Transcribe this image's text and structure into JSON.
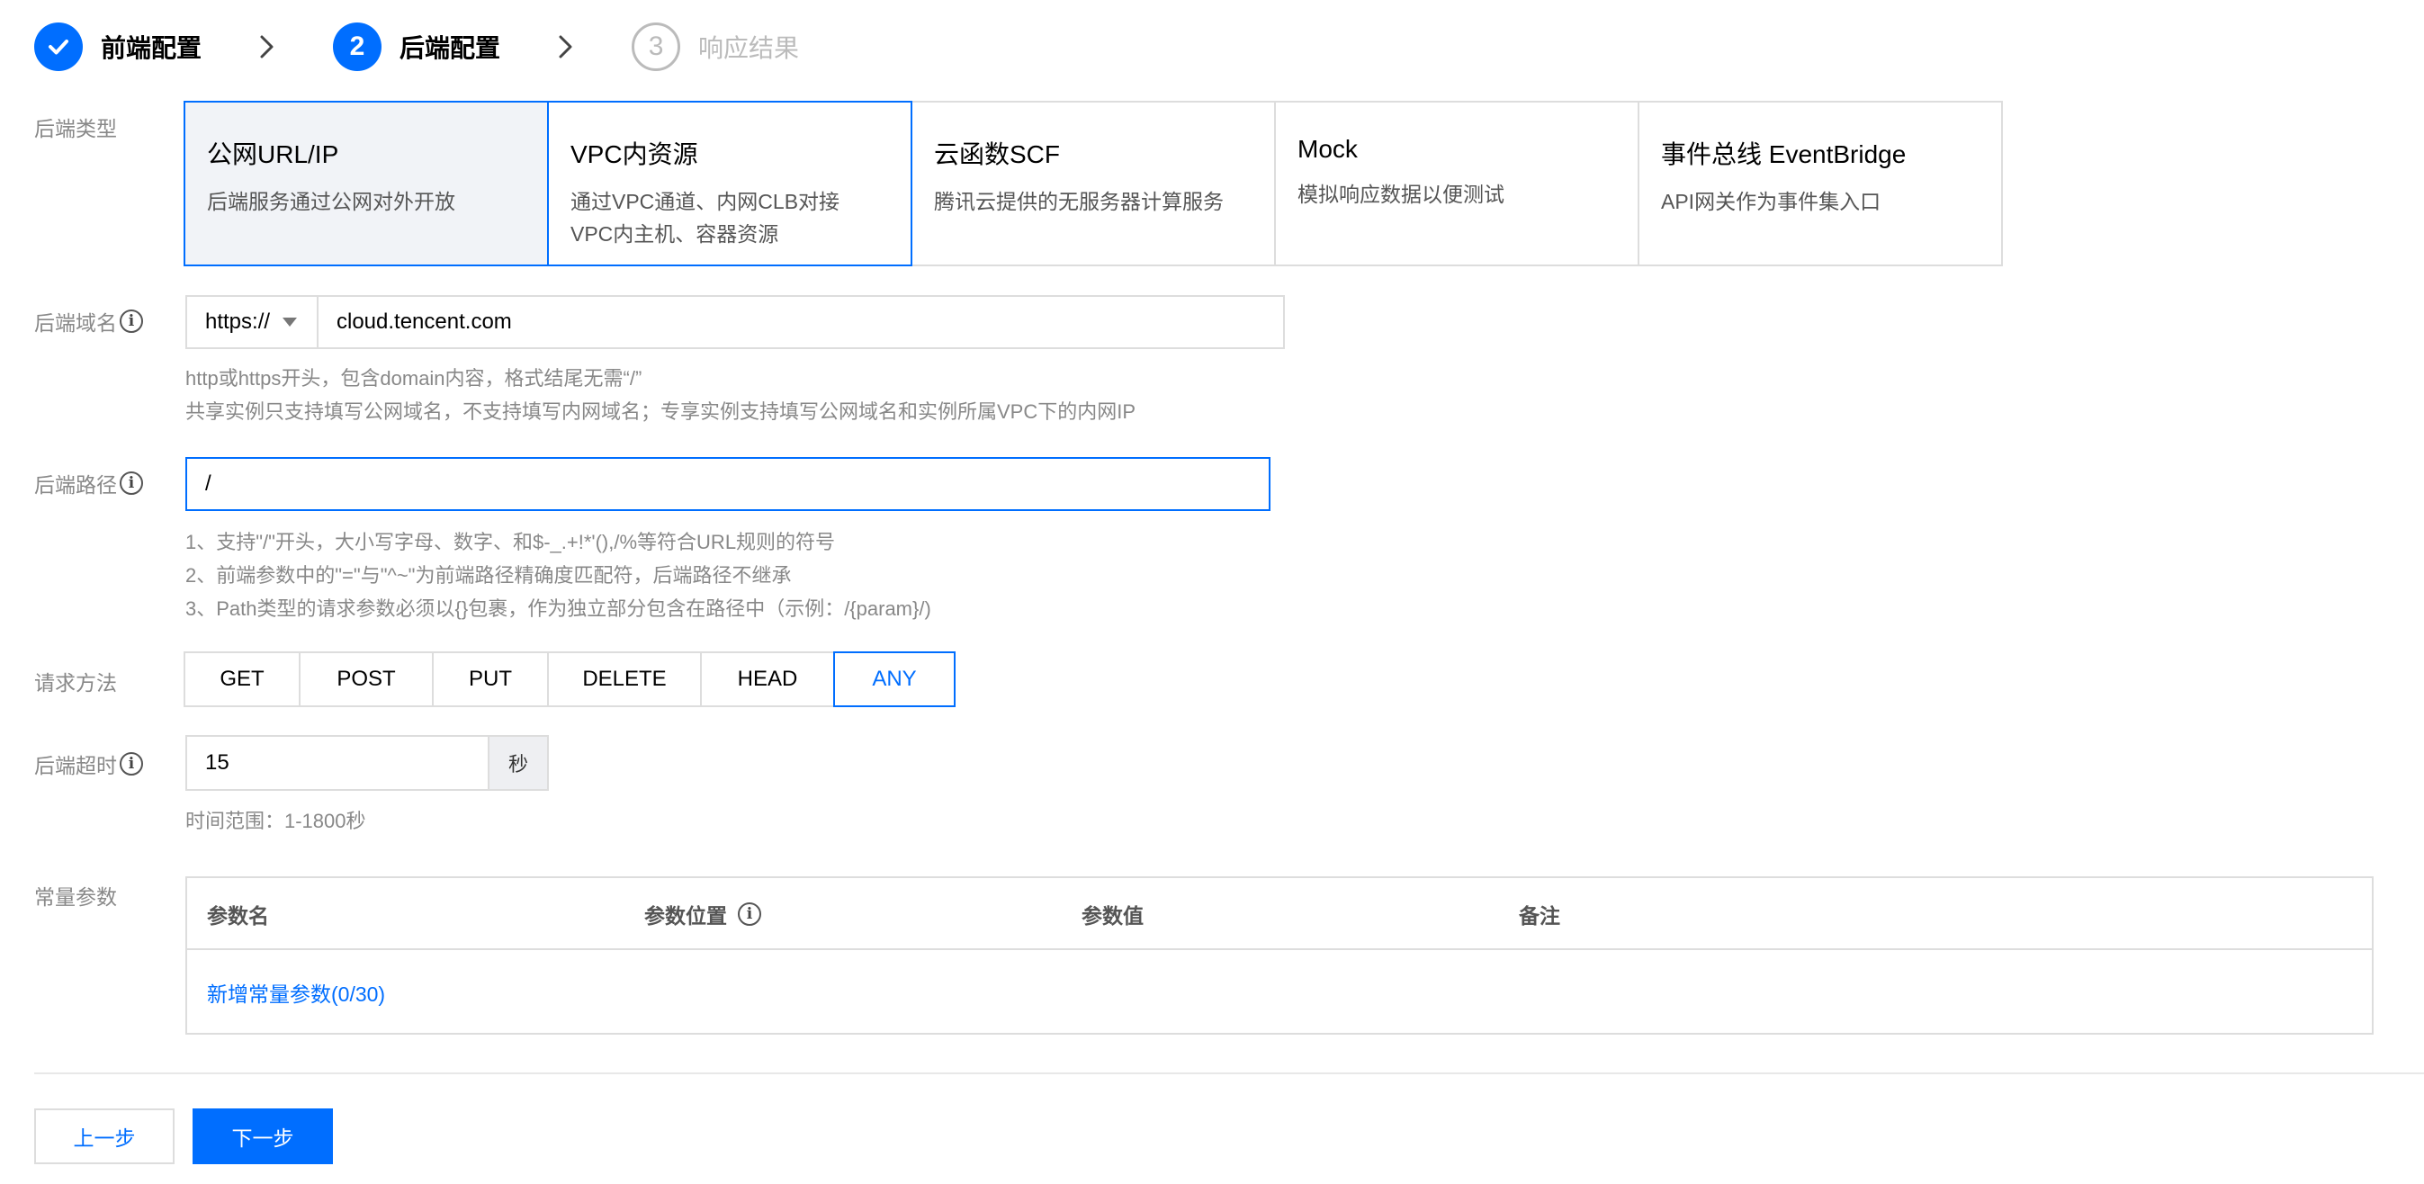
{
  "steps": [
    {
      "label": "前端配置",
      "state": "done",
      "number": "1"
    },
    {
      "label": "后端配置",
      "state": "active",
      "number": "2"
    },
    {
      "label": "响应结果",
      "state": "todo",
      "number": "3"
    }
  ],
  "backend_type": {
    "label": "后端类型",
    "options": [
      {
        "title": "公网URL/IP",
        "desc": "后端服务通过公网对外开放"
      },
      {
        "title": "VPC内资源",
        "desc": "通过VPC通道、内网CLB对接\nVPC内主机、容器资源"
      },
      {
        "title": "云函数SCF",
        "desc": "腾讯云提供的无服务器计算服务"
      },
      {
        "title": "Mock",
        "desc": "模拟响应数据以便测试"
      },
      {
        "title": "事件总线 EventBridge",
        "desc": "API网关作为事件集入口"
      }
    ]
  },
  "domain": {
    "label": "后端域名",
    "protocol": "https://",
    "value": "cloud.tencent.com",
    "hint1": "http或https开头，包含domain内容，格式结尾无需“/”",
    "hint2": "共享实例只支持填写公网域名，不支持填写内网域名；专享实例支持填写公网域名和实例所属VPC下的内网IP"
  },
  "path": {
    "label": "后端路径",
    "value": "/",
    "hint1": "1、支持\"/\"开头，大小写字母、数字、和$-_.+!*'(),/%等符合URL规则的符号",
    "hint2": "2、前端参数中的\"=\"与\"^~\"为前端路径精确度匹配符，后端路径不继承",
    "hint3": "3、Path类型的请求参数必须以{}包裹，作为独立部分包含在路径中（示例：/{param}/)"
  },
  "method": {
    "label": "请求方法",
    "options": [
      "GET",
      "POST",
      "PUT",
      "DELETE",
      "HEAD",
      "ANY"
    ],
    "selected": "ANY"
  },
  "timeout": {
    "label": "后端超时",
    "value": "15",
    "unit": "秒",
    "hint": "时间范围：1-1800秒"
  },
  "constant_params": {
    "label": "常量参数",
    "columns": [
      "参数名",
      "参数位置",
      "参数值",
      "备注"
    ],
    "add_link": "新增常量参数(0/30)"
  },
  "footer": {
    "prev_label": "上一步",
    "next_label": "下一步"
  },
  "colors": {
    "accent": "#006eff",
    "border": "#dddddd",
    "muted_text": "#888888"
  }
}
